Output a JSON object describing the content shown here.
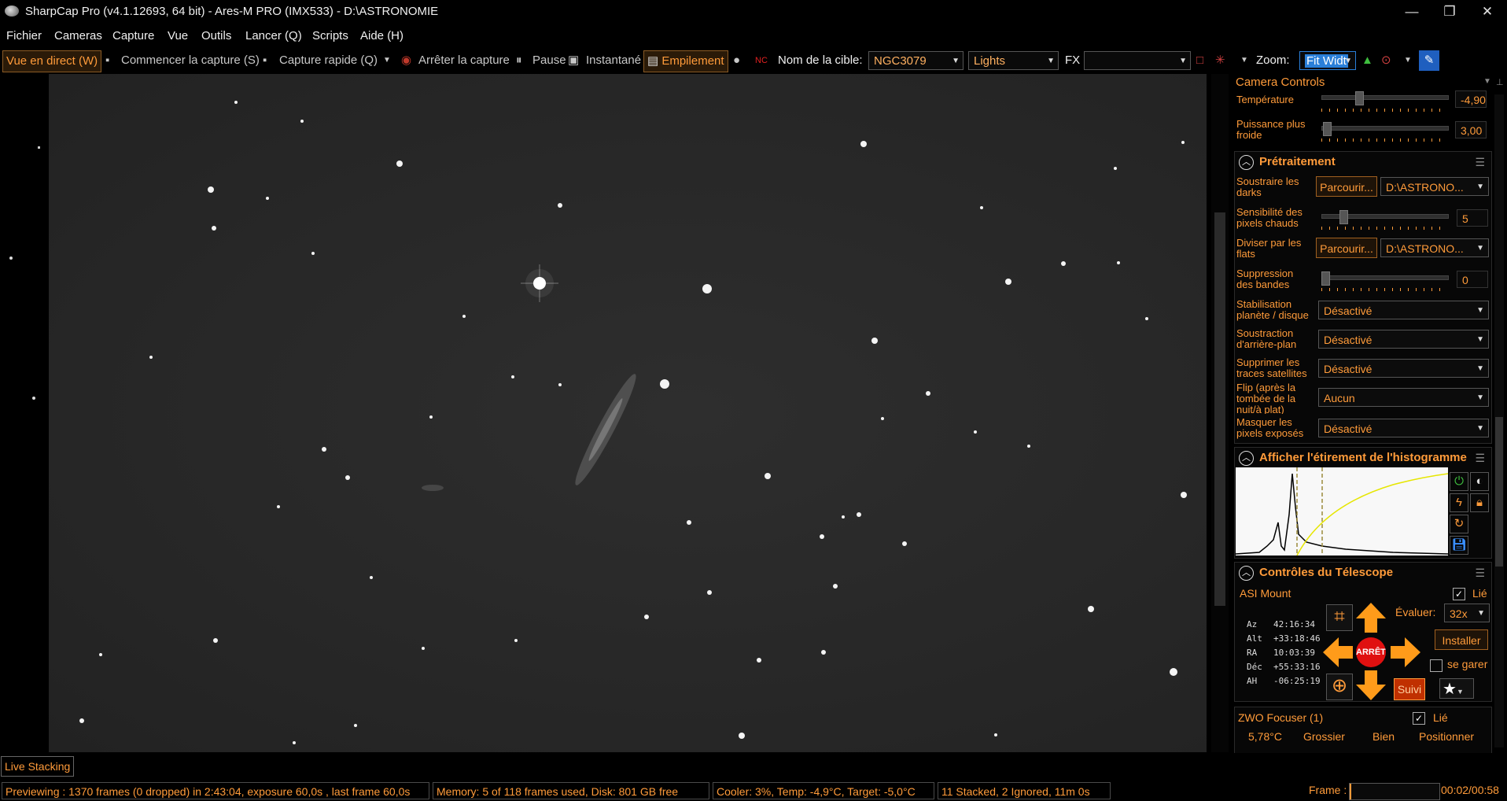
{
  "window": {
    "title": "SharpCap Pro (v4.1.12693, 64 bit) - Ares-M PRO (IMX533) - D:\\ASTRONOMIE",
    "minimize": "—",
    "maximize": "❐",
    "close": "✕"
  },
  "menu": [
    "Fichier",
    "Cameras",
    "Capture",
    "Vue",
    "Outils",
    "Lancer (Q)",
    "Scripts",
    "Aide (H)"
  ],
  "toolbar": {
    "live_view": "Vue en direct (W)",
    "start_capture": "Commencer la capture (S)",
    "quick_capture": "Capture rapide (Q)",
    "stop_capture": "Arrêter la capture",
    "pause": "Pause",
    "snapshot": "Instantané",
    "stacking": "Empilement",
    "target_label": "Nom de la cible:",
    "target_value": "NGC3079",
    "frame_type": "Lights",
    "fx_label": "FX",
    "fx_value": "",
    "zoom_label": "Zoom:",
    "zoom_value": "Fit Widt"
  },
  "camera_controls": {
    "title": "Camera Controls",
    "temperature_label": "Température",
    "temperature_value": "-4,90",
    "cooler_power_label": "Puissance plus froide",
    "cooler_power_value": "3,00"
  },
  "preprocessing": {
    "title": "Prétraitement",
    "subtract_darks_label": "Soustraire les darks",
    "browse1": "Parcourir...",
    "dark_path": "D:\\ASTRONO...",
    "hot_pixel_label": "Sensibilité des pixels chauds",
    "hot_pixel_value": "5",
    "hot_pixel_level": 0.15,
    "divide_flats_label": "Diviser par les flats",
    "browse2": "Parcourir...",
    "flat_path": "D:\\ASTRONO...",
    "banding_label": "Suppression des bandes",
    "banding_value": "0",
    "banding_level": 0.0,
    "stabilisation_label": "Stabilisation planète / disque",
    "stabilisation_value": "Désactivé",
    "background_label": "Soustraction d'arrière-plan",
    "background_value": "Désactivé",
    "satellite_label": "Supprimer les traces satellites",
    "satellite_value": "Désactivé",
    "flip_label": "Flip (après la tombée de la nuit/à plat)",
    "flip_value": "Aucun",
    "mask_label": "Masquer les pixels exposés",
    "mask_value": "Désactivé"
  },
  "histogram": {
    "title": "Afficher l'étirement de l'histogramme"
  },
  "telescope": {
    "title": "Contrôles du Télescope",
    "mount_name": "ASI Mount",
    "linked_label": "Lié",
    "coords": [
      {
        "k": "Az",
        "v": "42:16:34"
      },
      {
        "k": "Alt",
        "v": "+33:18:46"
      },
      {
        "k": "RA",
        "v": "10:03:39"
      },
      {
        "k": "Déc",
        "v": "+55:33:16"
      },
      {
        "k": "AH",
        "v": "-06:25:19"
      }
    ],
    "stop_label": "ARRÊTE",
    "rate_label": "Évaluer:",
    "rate_value": "32x",
    "install_label": "Installer",
    "park_label": "se garer",
    "tracking_label": "Suivi"
  },
  "focuser": {
    "name": "ZWO Focuser (1)",
    "linked_label": "Lié",
    "temperature": "5,78°C",
    "coarse": "Grossier",
    "fine": "Bien",
    "position": "Positionner"
  },
  "live_stacking_tab": "Live Stacking",
  "status": {
    "preview": "Previewing : 1370 frames (0 dropped) in 2:43:04, exposure 60,0s , last frame 60,0s",
    "memory": "Memory: 5 of 118 frames used, Disk: 801 GB free",
    "cooler": "Cooler: 3%, Temp: -4,9°C, Target: -5,0°C",
    "stack": "11 Stacked, 2 Ignored, 11m 0s",
    "frame_label": "Frame :",
    "frame_time": "00:02/00:58"
  },
  "colors": {
    "accent": "#ff9b3a",
    "background": "#000000",
    "image_bg": "#272727",
    "stop_red": "#e01010"
  }
}
